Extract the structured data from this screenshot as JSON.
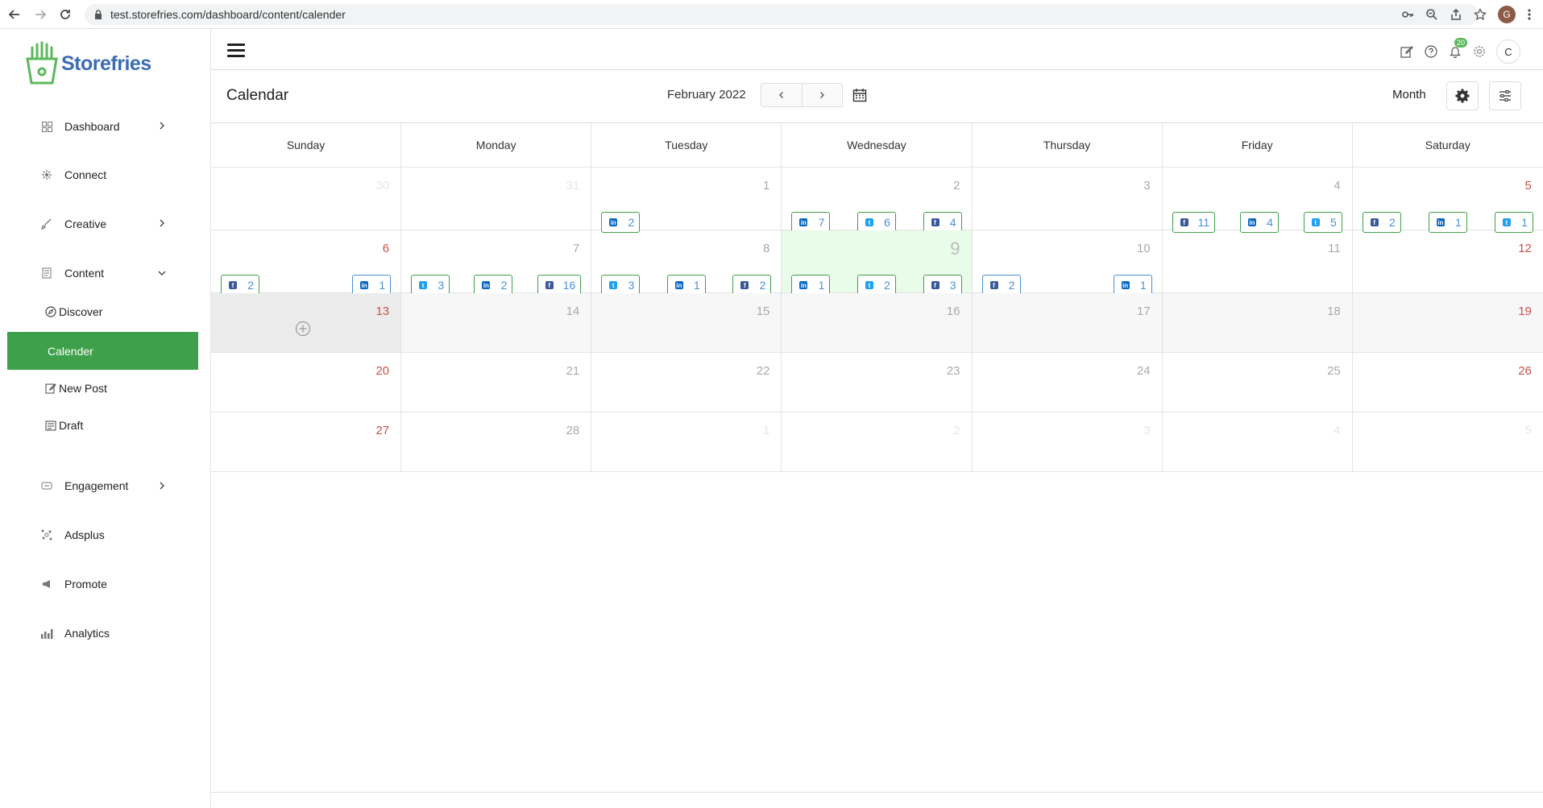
{
  "browser": {
    "url": "test.storefries.com/dashboard/content/calender",
    "profile_initial": "G"
  },
  "brand": {
    "name": "Storefries"
  },
  "sidebar": {
    "items": [
      {
        "label": "Dashboard",
        "icon": "grid-icon"
      },
      {
        "label": "Connect",
        "icon": "connect-icon"
      },
      {
        "label": "Creative",
        "icon": "brush-icon"
      },
      {
        "label": "Content",
        "icon": "content-icon"
      },
      {
        "label": "Engagement",
        "icon": "engagement-icon"
      },
      {
        "label": "Adsplus",
        "icon": "adsplus-icon"
      },
      {
        "label": "Promote",
        "icon": "megaphone-icon"
      },
      {
        "label": "Analytics",
        "icon": "bar-chart-icon"
      }
    ],
    "content_sub": [
      {
        "label": "Discover",
        "icon": "compass-icon"
      },
      {
        "label": "Calender",
        "icon": "",
        "active": true
      },
      {
        "label": "New Post",
        "icon": "edit-icon"
      },
      {
        "label": "Draft",
        "icon": "draft-icon"
      }
    ]
  },
  "topbar": {
    "notification_count": "20",
    "avatar_initial": "C"
  },
  "calendar": {
    "title": "Calendar",
    "month": "February 2022",
    "view": "Month",
    "days_of_week": [
      "Sunday",
      "Monday",
      "Tuesday",
      "Wednesday",
      "Thursday",
      "Friday",
      "Saturday"
    ],
    "weeks": [
      [
        {
          "d": "30",
          "other": true,
          "posts": []
        },
        {
          "d": "31",
          "other": true,
          "posts": []
        },
        {
          "d": "1",
          "posts": [
            {
              "net": "li",
              "n": "2"
            }
          ]
        },
        {
          "d": "2",
          "posts": [
            {
              "net": "li",
              "n": "7"
            },
            {
              "net": "tw",
              "n": "6"
            },
            {
              "net": "fb",
              "n": "4"
            }
          ]
        },
        {
          "d": "3",
          "posts": []
        },
        {
          "d": "4",
          "posts": [
            {
              "net": "fb",
              "n": "11"
            },
            {
              "net": "li",
              "n": "4"
            },
            {
              "net": "tw",
              "n": "5"
            }
          ]
        },
        {
          "d": "5",
          "weekend": true,
          "posts": [
            {
              "net": "fb",
              "n": "2"
            },
            {
              "net": "li",
              "n": "1"
            },
            {
              "net": "tw",
              "n": "1"
            }
          ]
        }
      ],
      [
        {
          "d": "6",
          "weekend": true,
          "posts": [
            {
              "net": "fb",
              "n": "2"
            },
            {
              "net": "li",
              "n": "1",
              "blue": true
            }
          ]
        },
        {
          "d": "7",
          "posts": [
            {
              "net": "tw",
              "n": "3"
            },
            {
              "net": "li",
              "n": "2"
            },
            {
              "net": "fb",
              "n": "16"
            }
          ]
        },
        {
          "d": "8",
          "posts": [
            {
              "net": "tw",
              "n": "3"
            },
            {
              "net": "li",
              "n": "1"
            },
            {
              "net": "fb",
              "n": "2"
            }
          ]
        },
        {
          "d": "9",
          "today": true,
          "posts": [
            {
              "net": "li",
              "n": "1"
            },
            {
              "net": "tw",
              "n": "2"
            },
            {
              "net": "fb",
              "n": "3"
            }
          ]
        },
        {
          "d": "10",
          "posts": [
            {
              "net": "fb",
              "n": "2",
              "blue": true
            },
            {
              "net": "li",
              "n": "1",
              "blue": true
            }
          ]
        },
        {
          "d": "11",
          "posts": []
        },
        {
          "d": "12",
          "weekend": true,
          "posts": []
        }
      ],
      [
        {
          "d": "13",
          "weekend": true,
          "hover": true,
          "posts": []
        },
        {
          "d": "14",
          "shaded": true,
          "posts": []
        },
        {
          "d": "15",
          "shaded": true,
          "posts": []
        },
        {
          "d": "16",
          "shaded": true,
          "posts": []
        },
        {
          "d": "17",
          "shaded": true,
          "posts": []
        },
        {
          "d": "18",
          "shaded": true,
          "posts": []
        },
        {
          "d": "19",
          "weekend": true,
          "shaded": true,
          "posts": []
        }
      ],
      [
        {
          "d": "20",
          "weekend": true,
          "posts": []
        },
        {
          "d": "21",
          "posts": []
        },
        {
          "d": "22",
          "posts": []
        },
        {
          "d": "23",
          "posts": []
        },
        {
          "d": "24",
          "posts": []
        },
        {
          "d": "25",
          "posts": []
        },
        {
          "d": "26",
          "weekend": true,
          "posts": []
        }
      ],
      [
        {
          "d": "27",
          "weekend": true,
          "posts": []
        },
        {
          "d": "28",
          "posts": []
        },
        {
          "d": "1",
          "other": true,
          "posts": []
        },
        {
          "d": "2",
          "other": true,
          "posts": []
        },
        {
          "d": "3",
          "other": true,
          "posts": []
        },
        {
          "d": "4",
          "other": true,
          "posts": []
        },
        {
          "d": "5",
          "other": true,
          "posts": []
        }
      ]
    ]
  }
}
